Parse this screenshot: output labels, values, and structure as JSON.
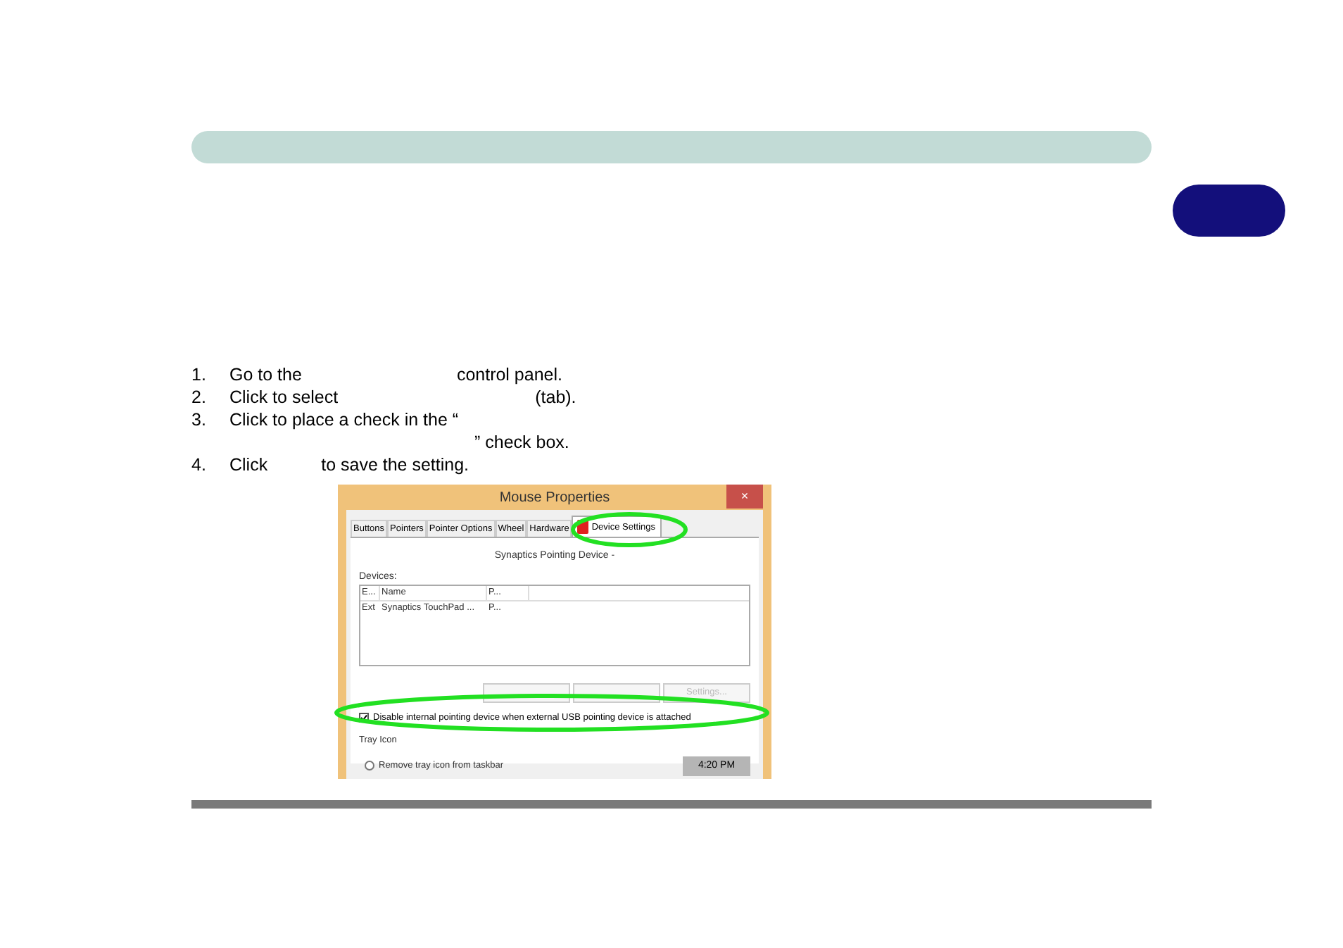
{
  "steps": [
    {
      "number": "1.",
      "parts": [
        "Go to the",
        "control panel."
      ]
    },
    {
      "number": "2.",
      "parts": [
        "Click to select",
        "(tab)."
      ]
    },
    {
      "number": "3.",
      "parts": [
        "Click to place a check in the “",
        "” check box."
      ]
    },
    {
      "number": "4.",
      "parts": [
        "Click",
        "to save the setting."
      ]
    }
  ],
  "dialog": {
    "title": "Mouse Properties",
    "close": "×",
    "tabs": [
      {
        "label": "Buttons",
        "selected": false
      },
      {
        "label": "Pointers",
        "selected": false
      },
      {
        "label": "Pointer Options",
        "selected": false
      },
      {
        "label": "Wheel",
        "selected": false
      },
      {
        "label": "Hardware",
        "selected": false
      },
      {
        "label": "Device Settings",
        "selected": true
      }
    ],
    "device_title": "Synaptics Pointing Device -",
    "devices_label": "Devices:",
    "columns": [
      "E...",
      "Name",
      "P..."
    ],
    "rows": [
      [
        "Ext",
        "Synaptics TouchPad ...",
        "P..."
      ]
    ],
    "buttons": [
      {
        "disabled": true
      },
      {
        "disabled": true
      },
      {
        "label": "Settings...",
        "disabled": true
      }
    ],
    "checkbox": {
      "label": "Disable internal pointing device when external USB pointing device is attached",
      "checked": true
    },
    "tray_label": "Tray Icon",
    "radio": {
      "label": "Remove tray icon from taskbar",
      "selected": false
    },
    "time": "4:20 PM"
  }
}
